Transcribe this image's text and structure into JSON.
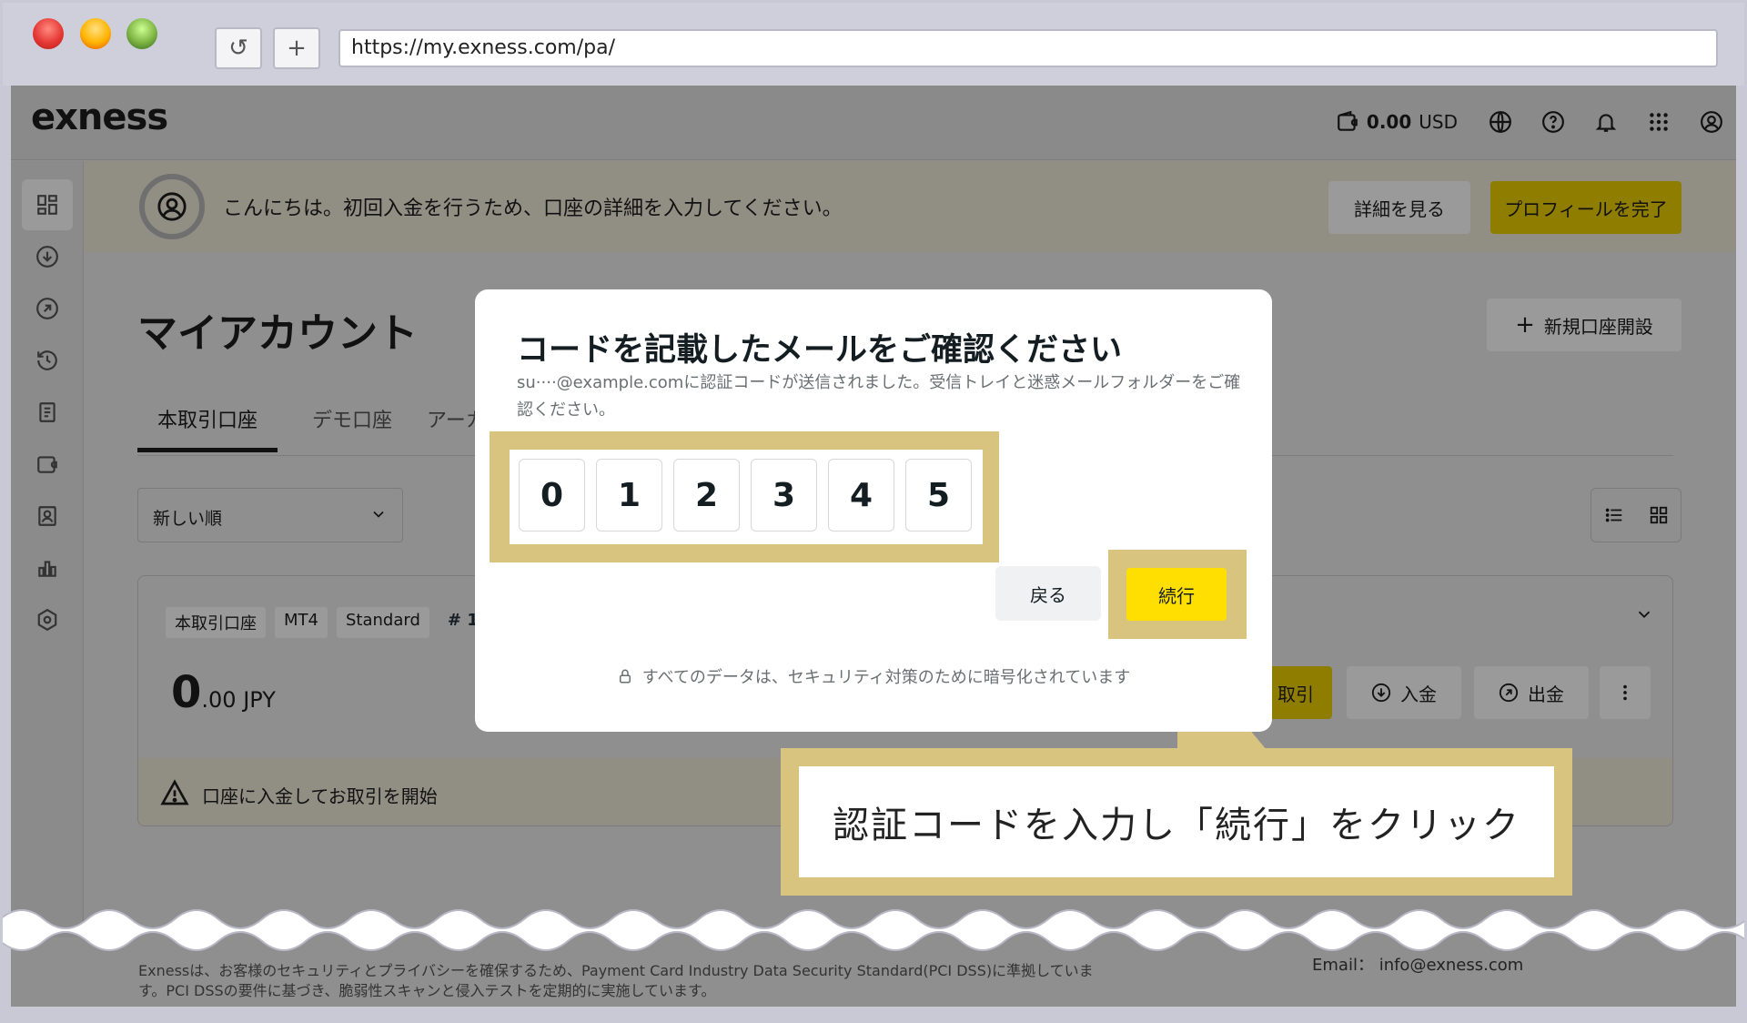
{
  "browser": {
    "url": "https://my.exness.com/pa/",
    "reload_glyph": "↺",
    "newtab_glyph": "+"
  },
  "header": {
    "logo": "exness",
    "balance_amount": "0.00",
    "balance_currency": "USD",
    "icons": [
      "wallet-icon",
      "globe-icon",
      "help-icon",
      "bell-icon",
      "apps-grid-icon",
      "user-icon"
    ]
  },
  "sidebar": {
    "items": [
      "dashboard-icon",
      "deposit-icon",
      "withdraw-icon",
      "history-icon",
      "documents-icon",
      "wallet-icon",
      "profile-card-icon",
      "analytics-icon",
      "settings-icon"
    ]
  },
  "banner": {
    "message": "こんにちは。初回入金を行うため、口座の詳細を入力してください。",
    "details_button": "詳細を見る",
    "complete_profile_button": "プロフィールを完了"
  },
  "main": {
    "title": "マイアカウント",
    "new_account_button": "新規口座開設",
    "tabs": [
      "本取引口座",
      "デモ口座",
      "アーカ"
    ],
    "sort_value": "新しい順"
  },
  "account_card": {
    "tags": [
      "本取引口座",
      "MT4",
      "Standard",
      "# 1"
    ],
    "balance_int": "0",
    "balance_dec": ".00 JPY",
    "trade_button": "取引",
    "deposit_button": "入金",
    "withdraw_button": "出金",
    "warning": "口座に入金してお取引を開始"
  },
  "footer": {
    "text": "Exnessは、お客様のセキュリティとプライバシーを確保するため、Payment Card Industry Data Security Standard(PCI DSS)に準拠しています。PCI DSSの要件に基づき、脆弱性スキャンと侵入テストを定期的に実施しています。",
    "email_label": "Email：",
    "email": "info@exness.com"
  },
  "modal": {
    "title": "コードを記載したメールをご確認ください",
    "description": "su····@example.comに認証コードが送信されました。受信トレイと迷惑メールフォルダーをご確認ください。",
    "digits": [
      "0",
      "1",
      "2",
      "3",
      "4",
      "5"
    ],
    "back_button": "戻る",
    "continue_button": "続行",
    "security_note": "すべてのデータは、セキュリティ対策のために暗号化されています"
  },
  "callout": {
    "text": "認証コードを入力し「続行」をクリック"
  },
  "colors": {
    "accent_yellow": "#ffde02",
    "callout_frame": "#d9c47f",
    "overlay": "#8f8f8f"
  }
}
